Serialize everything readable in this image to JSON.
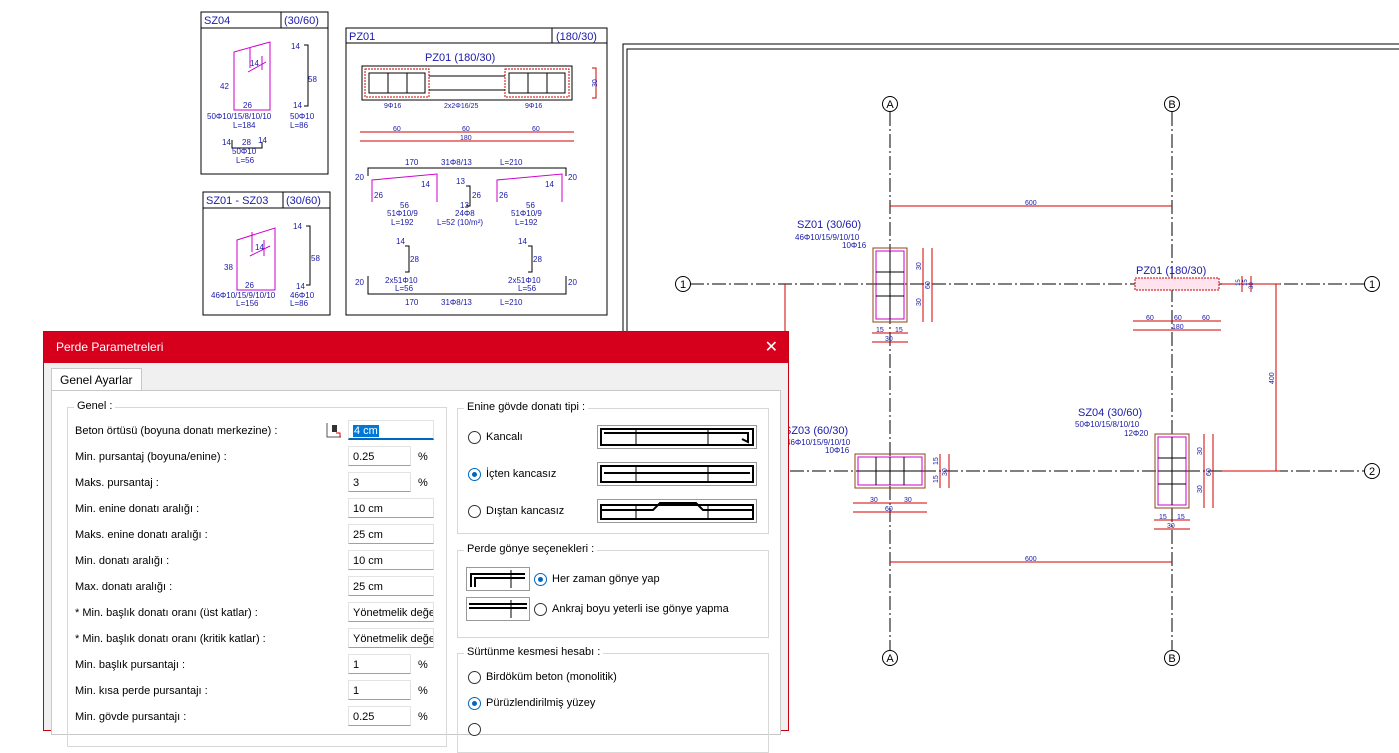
{
  "drawing": {
    "sz04_detail": {
      "title": "SZ04",
      "dim": "(30/60)",
      "d14a": "14",
      "d58": "58",
      "d42": "42",
      "d14b": "14",
      "d26": "26",
      "d14c": "14",
      "bar1": "50Φ10/15/8/10/10",
      "bar1_len": "L=184",
      "bar2": "50Φ10",
      "bar2_len": "L=86",
      "t14a": "14",
      "t28": "28",
      "t14b": "14",
      "bar3": "50Φ10",
      "bar3_len": "L=56"
    },
    "sz0103_detail": {
      "title": "SZ01 - SZ03",
      "dim": "(30/60)",
      "d14a": "14",
      "d58": "58",
      "d38": "38",
      "d14b": "14",
      "d26": "26",
      "d14c": "14",
      "bar1": "46Φ10/15/9/10/10",
      "bar1_len": "L=156",
      "bar2": "46Φ10",
      "bar2_len": "L=86"
    },
    "pz01_detail": {
      "title": "PZ01",
      "dim": "(180/30)",
      "section_title": "PZ01 (180/30)",
      "side_dim": "30",
      "left_bars": "9Φ16",
      "mid_bars": "2x2Φ16/25",
      "right_bars": "9Φ16",
      "w60a": "60",
      "w60b": "60",
      "w60c": "60",
      "w180": "180",
      "top_170": "170",
      "top_stirrup": "31Φ8/13",
      "top_len": "L=210",
      "e20a": "20",
      "e20b": "20",
      "h14a": "14",
      "h26a": "26",
      "h56a": "56",
      "h13a": "13",
      "h26b": "26",
      "h13b": "13",
      "h14b": "14",
      "h26c": "26",
      "h56b": "56",
      "bar_left": "51Φ10/9",
      "bar_left_len": "L=192",
      "bar_mid": "24Φ8",
      "bar_mid_len": "L=52 (10/m²)",
      "bar_right": "51Φ10/9",
      "bar_right_len": "L=192",
      "u14a": "14",
      "u28a": "28",
      "u14b": "14",
      "u28b": "28",
      "ub_left": "2x51Φ10",
      "ub_left_len": "L=56",
      "ub_right": "2x51Φ10",
      "ub_right_len": "L=56",
      "e20c": "20",
      "e20d": "20",
      "bot_170": "170",
      "bot_stirrup": "31Φ8/13",
      "bot_len": "L=210"
    },
    "plan": {
      "axis_a": "A",
      "axis_b": "B",
      "axis_1": "1",
      "axis_2": "2",
      "axis_a2": "A",
      "axis_b2": "B",
      "axis_12": "1",
      "axis_22": "2",
      "dim_600_top": "600",
      "dim_600_bot": "600",
      "dim_400": "400",
      "sz01_label": "SZ01 (30/60)",
      "sz01_bar1": "46Φ10/15/9/10/10",
      "sz01_bar2": "10Φ16",
      "sz01_w15a": "15",
      "sz01_w15b": "15",
      "sz01_w30": "30",
      "sz01_h30a": "30",
      "sz01_h30b": "30",
      "sz01_h60": "60",
      "pz01_label": "PZ01 (180/30)",
      "pz01_w60a": "60",
      "pz01_w60b": "60",
      "pz01_w60c": "60",
      "pz01_w180": "180",
      "pz01_h15a": "15",
      "pz01_h15b": "15",
      "pz01_h30": "30",
      "sz03_label": "SZ03 (60/30)",
      "sz03_bar1": "46Φ10/15/9/10/10",
      "sz03_bar2": "10Φ16",
      "sz03_w30a": "30",
      "sz03_w30b": "30",
      "sz03_w60": "60",
      "sz03_h15a": "15",
      "sz03_h15b": "15",
      "sz03_h30": "30",
      "sz04_label": "SZ04 (30/60)",
      "sz04_bar1": "50Φ10/15/8/10/10",
      "sz04_bar2": "12Φ20",
      "sz04_w15a": "15",
      "sz04_w15b": "15",
      "sz04_w30": "30",
      "sz04_h30a": "30",
      "sz04_h30b": "30",
      "sz04_h60": "60"
    }
  },
  "colors": {
    "section_frame": "#000000",
    "dimension": "#d00000",
    "rebar": "#cc00cc",
    "label": "#1a1aa8",
    "grid": "#000000",
    "titlebar": "#d6001c"
  },
  "dialog": {
    "title": "Perde Parametreleri",
    "close_icon": "close-icon",
    "tab_general": "Genel Ayarlar",
    "genel": {
      "title": "Genel :",
      "rows": [
        {
          "label": "Beton örtüsü (boyuna donatı merkezine) :",
          "value": "4 cm",
          "unit": ""
        },
        {
          "label": "Min. pursantaj (boyuna/enine) :",
          "value": "0.25",
          "unit": "%"
        },
        {
          "label": "Maks. pursantaj :",
          "value": "3",
          "unit": "%"
        },
        {
          "label": "Min. enine donatı aralığı :",
          "value": "10 cm",
          "unit": ""
        },
        {
          "label": "Maks. enine donatı aralığı :",
          "value": "25 cm",
          "unit": ""
        },
        {
          "label": "Min. donatı aralığı :",
          "value": "10 cm",
          "unit": ""
        },
        {
          "label": "Max. donatı aralığı :",
          "value": "25 cm",
          "unit": ""
        },
        {
          "label": "* Min. başlık donatı oranı (üst katlar) :",
          "value": "Yönetmelik değe",
          "unit": ""
        },
        {
          "label": "* Min. başlık donatı oranı (kritik katlar) :",
          "value": "Yönetmelik değe",
          "unit": ""
        },
        {
          "label": "Min. başlık pursantajı :",
          "value": "1",
          "unit": "%"
        },
        {
          "label": "Min. kısa perde pursantajı :",
          "value": "1",
          "unit": "%"
        },
        {
          "label": "Min. gövde pursantajı :",
          "value": "0.25",
          "unit": "%"
        }
      ]
    },
    "enine": {
      "title": "Enine gövde donatı tipi :",
      "options": [
        {
          "label": "Kancalı",
          "selected": false
        },
        {
          "label": "İçten kancasız",
          "selected": true
        },
        {
          "label": "Dıştan kancasız",
          "selected": false
        }
      ]
    },
    "gonye": {
      "title": "Perde gönye seçenekleri :",
      "options": [
        {
          "label": "Her zaman gönye yap",
          "selected": true
        },
        {
          "label": "Ankraj boyu yeterli ise gönye yapma",
          "selected": false
        }
      ]
    },
    "surtunme": {
      "title": "Sürtünme kesmesi hesabı :",
      "options": [
        {
          "label": "Birdöküm beton (monolitik)",
          "selected": false
        },
        {
          "label": "Pürüzlendirilmiş yüzey",
          "selected": true
        }
      ]
    }
  }
}
